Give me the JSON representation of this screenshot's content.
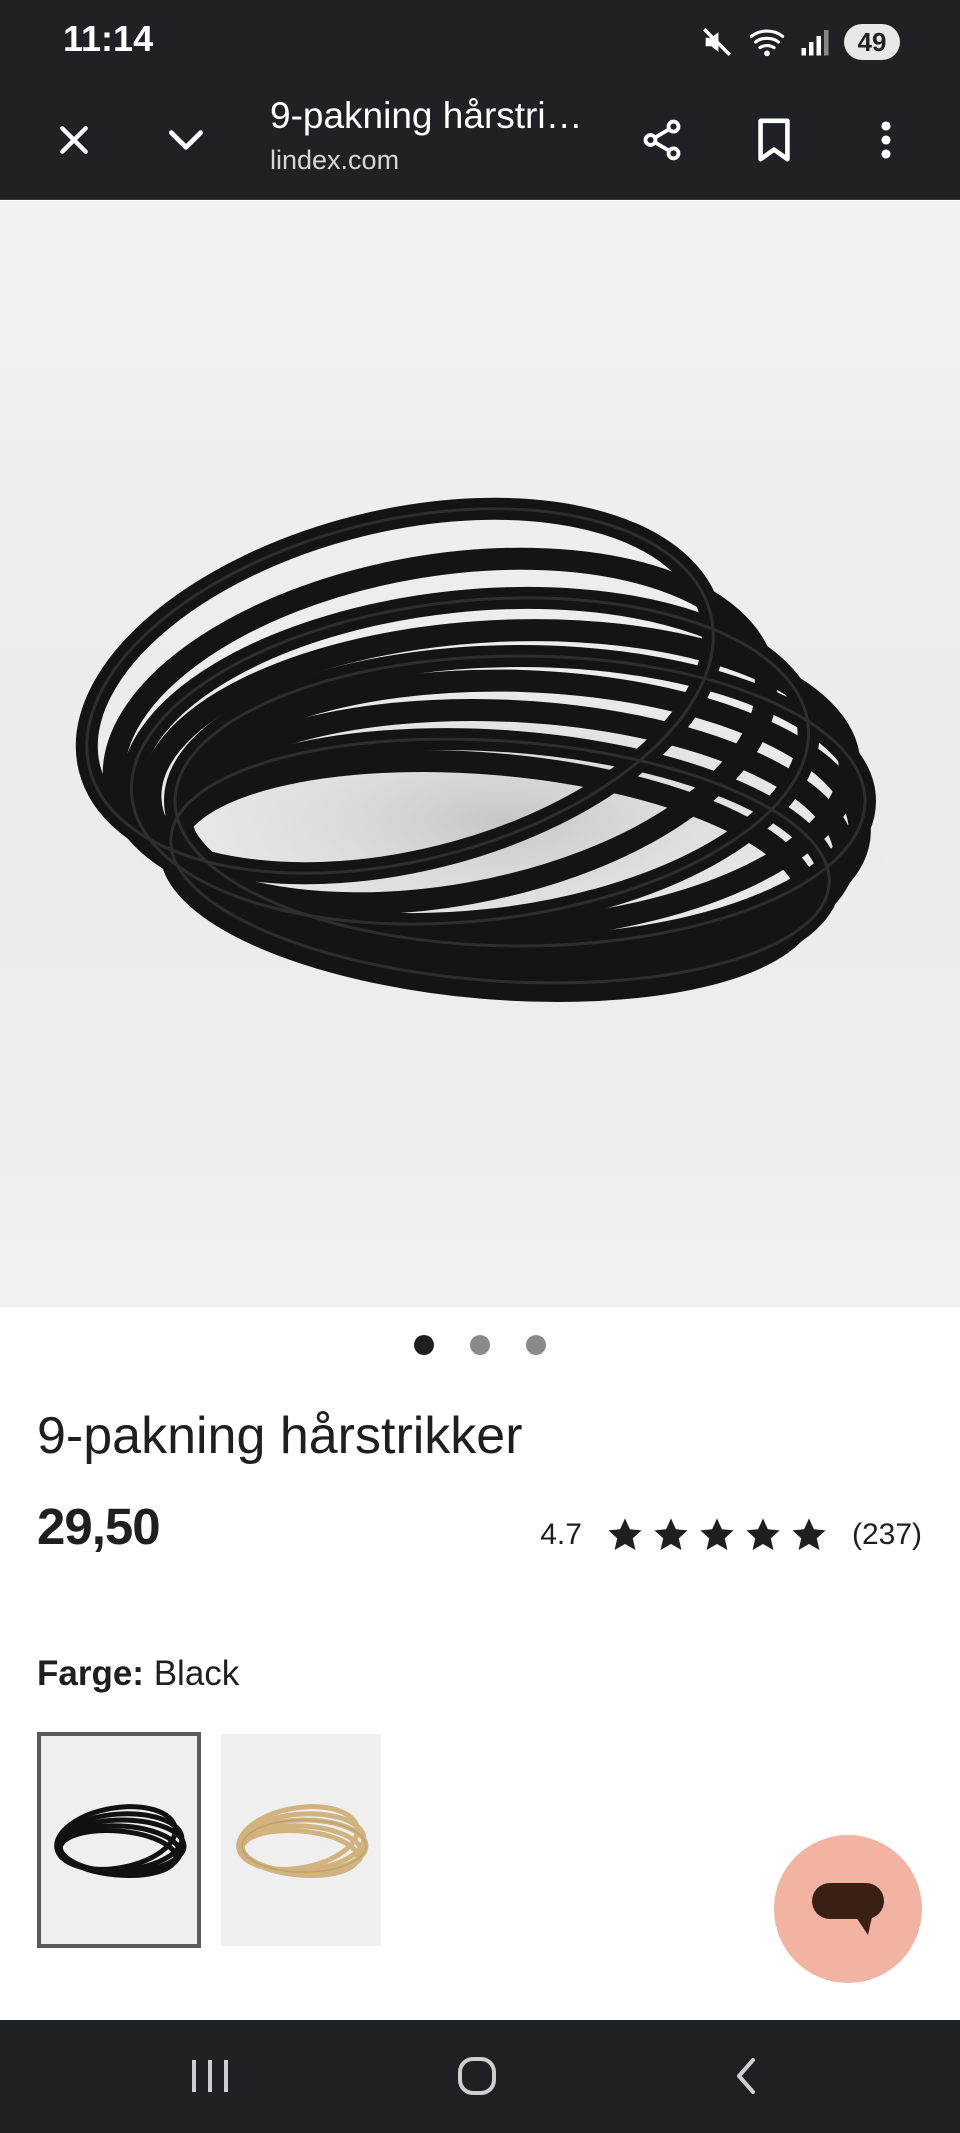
{
  "status_bar": {
    "time": "11:14",
    "battery": "49",
    "icons": [
      "mute-icon",
      "wifi-icon",
      "signal-icon",
      "battery-icon"
    ]
  },
  "toolbar": {
    "title": "9-pakning hårstrikker",
    "domain": "lindex.com",
    "icons": [
      "close-icon",
      "chevron-down-icon",
      "share-icon",
      "bookmark-icon",
      "more-vert-icon"
    ]
  },
  "product": {
    "image_alt": "black-hair-ties-photo",
    "carousel": {
      "count": 3,
      "active_index": 0
    },
    "title": "9-pakning hårstrikker",
    "price": "29,50",
    "rating": {
      "score": "4.7",
      "stars": 5,
      "count": "(237)"
    },
    "color": {
      "label": "Farge:",
      "value": "Black"
    },
    "swatches": [
      {
        "name": "Black",
        "color": "#111111",
        "selected": true
      },
      {
        "name": "Beige",
        "color": "#d6b98c",
        "selected": false
      }
    ]
  },
  "chat_button": {
    "icon": "chat-bubble-icon",
    "color": "#f3b3a2"
  },
  "nav_bar": {
    "icons": [
      "recents-icon",
      "home-icon",
      "back-icon"
    ]
  },
  "colors": {
    "system_bar": "#202124",
    "text": "#1f1f1f",
    "accent": "#f3b3a2"
  }
}
